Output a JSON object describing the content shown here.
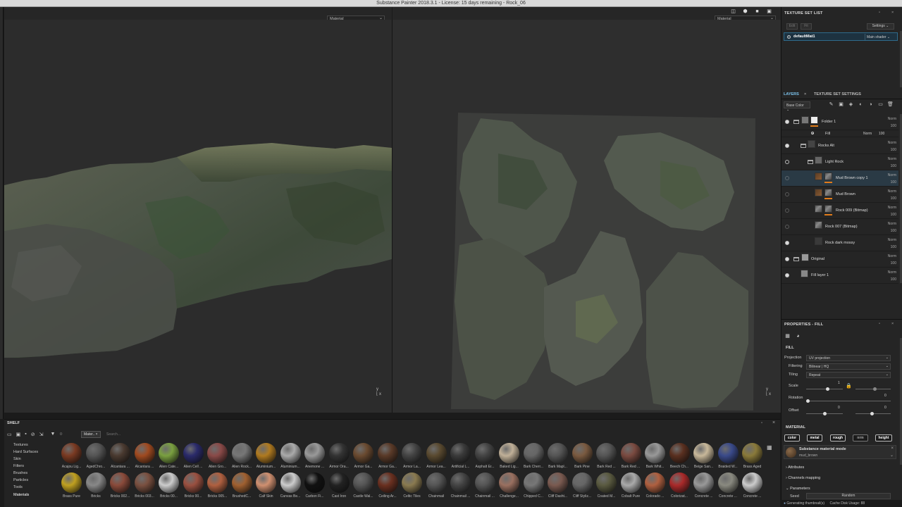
{
  "app_title": "Substance Painter 2018.3.1 - License: 15 days remaining - Rock_06",
  "viewports": {
    "left_mode": "Material",
    "right_mode": "Material"
  },
  "texture_set_list": {
    "title": "TEXTURE SET LIST",
    "btn_edit": "Edit",
    "btn_fit": "Fit",
    "settings": "Settings",
    "item_name": "defaultMat1",
    "item_shader": "Main shader"
  },
  "layers_panel": {
    "tab_layers": "LAYERS",
    "tab_tss": "TEXTURE SET SETTINGS",
    "channel": "Base Color",
    "items": [
      {
        "name": "Folder 1",
        "blend": "Norm",
        "opacity": "100",
        "visible": "on"
      },
      {
        "name": "Rocks Alt",
        "blend": "Norm",
        "opacity": "100",
        "visible": "on"
      },
      {
        "name": "Light Rock",
        "blend": "Norm",
        "opacity": "100",
        "visible": "off"
      },
      {
        "name": "Mud Brown copy 1",
        "blend": "Norm",
        "opacity": "100",
        "visible": "dim"
      },
      {
        "name": "Mud Brown",
        "blend": "Norm",
        "opacity": "100",
        "visible": "dim"
      },
      {
        "name": "Rock 009 (Bitmap)",
        "blend": "Norm",
        "opacity": "100",
        "visible": "dim"
      },
      {
        "name": "Rock 007 (Bitmap)",
        "blend": "Norm",
        "opacity": "100",
        "visible": "dim"
      },
      {
        "name": "Rock dark mossy",
        "blend": "Norm",
        "opacity": "100",
        "visible": "on"
      },
      {
        "name": "Original",
        "blend": "Norm",
        "opacity": "100",
        "visible": "on"
      },
      {
        "name": "Fill layer 1",
        "blend": "Norm",
        "opacity": "100",
        "visible": "on"
      }
    ],
    "fill_sub": {
      "name": "Fill",
      "blend": "Norm",
      "opacity": "100"
    }
  },
  "properties": {
    "title": "PROPERTIES - FILL",
    "section_fill": "FILL",
    "projection_label": "Projection",
    "projection_value": "UV projection",
    "filtering_label": "Filtering",
    "filtering_value": "Bilinear | HQ",
    "tiling_label": "Tiling",
    "tiling_value": "Repeat",
    "scale_label": "Scale",
    "scale_value": "1",
    "rotation_label": "Rotation",
    "rotation_value": "0",
    "offset_label": "Offset",
    "offset_x": "0",
    "offset_y": "0",
    "section_material": "MATERIAL",
    "chips": [
      "color",
      "metal",
      "rough",
      "nrm",
      "height"
    ],
    "sbs_mode": "Substance material mode",
    "sbs_name": "mud_brown",
    "attributes": "Attributes",
    "channels_mapping": "Channels mapping",
    "parameters": "Parameters",
    "seed_label": "Seed",
    "seed_value": "Random"
  },
  "shelf": {
    "title": "SHELF",
    "filter_tag": "Mater..",
    "search_placeholder": "Search...",
    "categories": [
      "Textures",
      "Hard Surfaces",
      "Skin",
      "Filters",
      "Brushes",
      "Particles",
      "Tools",
      "Materials"
    ],
    "row1": [
      "Acajou Lig...",
      "AgedChro...",
      "Alcantara ...",
      "Alcantara ...",
      "Alien Cate...",
      "Alien Cell ...",
      "Alien Gro...",
      "Alien Rock...",
      "Aluminium...",
      "Aluminium...",
      "Anemone ...",
      "Armor Ora...",
      "Armor Ga...",
      "Armor Ga...",
      "Armor La...",
      "Armor Lea...",
      "Artificial L...",
      "Asphalt Er...",
      "Baked Lig...",
      "Bark Cherr...",
      "Bark Mapl...",
      "Bark Pine",
      "Bark Red ...",
      "Bark Red ...",
      "Bark Whit...",
      "Beech Ch...",
      "Beige San...",
      "Braided W...",
      "Brass Aged"
    ],
    "row2": [
      "Brass Pure",
      "Bricks",
      "Bricks 002...",
      "Bricks 003...",
      "Bricks 00...",
      "Bricks 00...",
      "Bricks 005...",
      "BrushedC...",
      "Calf Skin",
      "Canvas Be...",
      "Carbon Fi...",
      "Cast Iron",
      "Castle Wal...",
      "Ceiling Ar...",
      "Celtic Tiles",
      "Chainmail",
      "Chainmail ...",
      "Chainmail ...",
      "Challenge...",
      "Chipped C...",
      "Cliff Dasht...",
      "Cliff Styliz...",
      "Coated M...",
      "Cobalt Pure",
      "Colorado ...",
      "Colorizat...",
      "Concrete ...",
      "Concrete ...",
      "Concrete ..."
    ]
  },
  "status": {
    "generating": "Generating thumbnail(s)",
    "cache": "Cache Disk Usage:",
    "cache_value": "88"
  }
}
